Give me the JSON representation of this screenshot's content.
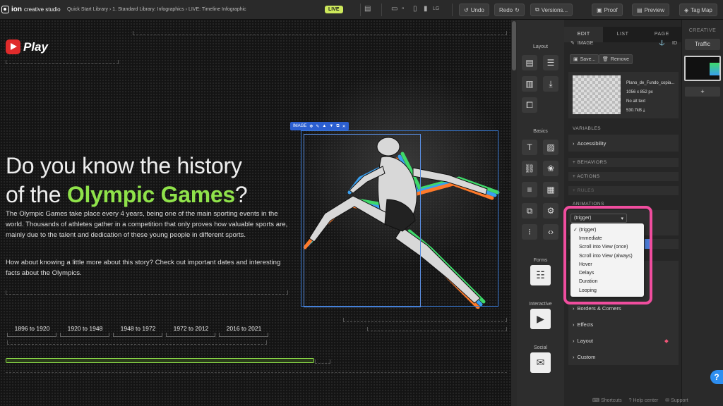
{
  "app": {
    "name": "ion",
    "subtitle": "creative studio"
  },
  "breadcrumb": "Quick Start Library  ›  1. Standard Library: Infographics  ›  LIVE: Timeline Infographic",
  "status_badge": "LIVE",
  "device_size_label": "LG",
  "toolbar": {
    "undo": "Undo",
    "redo": "Redo",
    "versions": "Versions...",
    "proof": "Proof",
    "preview": "Preview",
    "tag_map": "Tag Map"
  },
  "canvas": {
    "logo_text": "Play",
    "headline_line1": "Do you know the history",
    "headline_pre": "of the ",
    "headline_highlight": "Olympic Games",
    "headline_post": "?",
    "paragraph1": "The Olympic Games take place every 4 years, being one of the main sporting events in the world. Thousands of athletes gather in a competition that only proves how valuable sports are, mainly due to the talent and dedication of these young people in different sports.",
    "paragraph2": "How about knowing a little more about this story? Check out important dates and interesting facts about the Olympics.",
    "timeline": [
      "1896 to 1920",
      "1920 to 1948",
      "1948 to 1972",
      "1972 to 2012",
      "2016 to 2021"
    ],
    "progress_fraction": 1.0,
    "image_toolbar_label": "IMAGE"
  },
  "icon_panel": {
    "layout_label": "Layout",
    "basics_label": "Basics",
    "forms_label": "Forms",
    "interactive_label": "Interactive",
    "social_label": "Social"
  },
  "props": {
    "tabs": [
      "EDIT",
      "LIST",
      "PAGE"
    ],
    "section_title": "IMAGE",
    "id_label": "ID",
    "save_label": "Save...",
    "remove_label": "Remove",
    "file_name": "Plano_de_Fundo_copia...",
    "file_dims": "1056 x 852 px",
    "alt_text": "No alt text",
    "file_size": "530.7kB",
    "variables_head": "VARIABLES",
    "accessibility": "Accessibility",
    "behaviors": "+ BEHAVIORS",
    "actions": "+ ACTIONS",
    "rules": "+ RULES",
    "animations_head": "ANIMATIONS",
    "trigger_value": "(trigger)",
    "trigger_options": [
      "(trigger)",
      "Immediate",
      "Scroll into View (once)",
      "Scroll into View (always)",
      "Hover",
      "Delays",
      "Duration",
      "Looping"
    ],
    "sections": [
      "Borders & Corners",
      "Effects",
      "Layout",
      "Custom"
    ]
  },
  "creative": {
    "head": "CREATIVE",
    "traffic": "Traffic",
    "add": "+"
  },
  "bottom": {
    "shortcuts": "Shortcuts",
    "help_center": "Help center",
    "support": "Support"
  },
  "colors": {
    "accent_green": "#8fe24a",
    "highlight_pink": "#f04d9e",
    "selection_blue": "#3a7bd5"
  }
}
